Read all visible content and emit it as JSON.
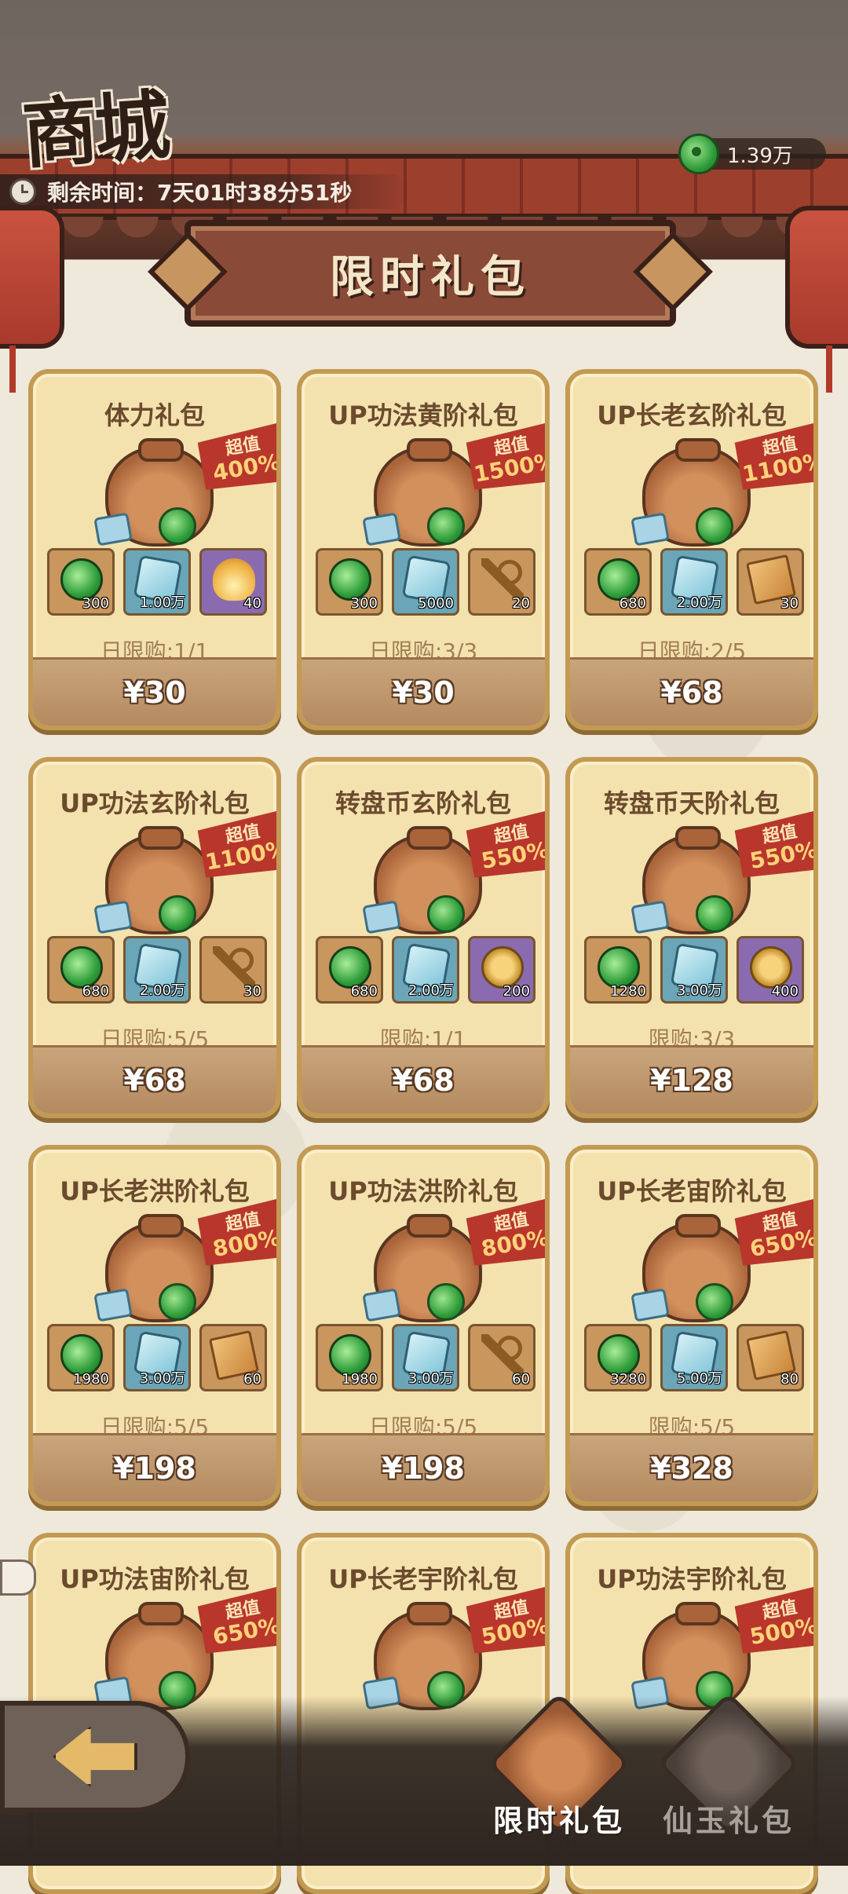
{
  "header": {
    "title": "商城",
    "timer_label": "剩余时间：",
    "timer_value": "7天01时38分51秒",
    "currency_amount": "1.39万",
    "banner": "限时礼包"
  },
  "cards": [
    {
      "name": "体力礼包",
      "badge_top": "超值",
      "badge_pct": "400%",
      "items": [
        {
          "icon": "jade-icon",
          "bg": "brown",
          "count": "300"
        },
        {
          "icon": "crystal-icon",
          "bg": "blue",
          "count": "1.00万"
        },
        {
          "icon": "flame-icon",
          "bg": "purple",
          "count": "40"
        }
      ],
      "limit": "日限购:1/1",
      "price": "¥30"
    },
    {
      "name": "UP功法黄阶礼包",
      "badge_top": "超值",
      "badge_pct": "1500%",
      "items": [
        {
          "icon": "jade-icon",
          "bg": "brown",
          "count": "300"
        },
        {
          "icon": "crystal-icon",
          "bg": "blue",
          "count": "5000"
        },
        {
          "icon": "key-icon",
          "bg": "brown",
          "count": "20"
        }
      ],
      "limit": "日限购:3/3",
      "price": "¥30"
    },
    {
      "name": "UP长老玄阶礼包",
      "badge_top": "超值",
      "badge_pct": "1100%",
      "items": [
        {
          "icon": "jade-icon",
          "bg": "brown",
          "count": "680"
        },
        {
          "icon": "crystal-icon",
          "bg": "blue",
          "count": "2.00万"
        },
        {
          "icon": "scroll-icon",
          "bg": "brown",
          "count": "30"
        }
      ],
      "limit": "日限购:2/5",
      "price": "¥68"
    },
    {
      "name": "UP功法玄阶礼包",
      "badge_top": "超值",
      "badge_pct": "1100%",
      "items": [
        {
          "icon": "jade-icon",
          "bg": "brown",
          "count": "680"
        },
        {
          "icon": "crystal-icon",
          "bg": "blue",
          "count": "2.00万"
        },
        {
          "icon": "key-icon",
          "bg": "brown",
          "count": "30"
        }
      ],
      "limit": "日限购:5/5",
      "price": "¥68"
    },
    {
      "name": "转盘币玄阶礼包",
      "badge_top": "超值",
      "badge_pct": "550%",
      "items": [
        {
          "icon": "jade-icon",
          "bg": "brown",
          "count": "680"
        },
        {
          "icon": "crystal-icon",
          "bg": "blue",
          "count": "2.00万"
        },
        {
          "icon": "coin-icon",
          "bg": "purple",
          "count": "200"
        }
      ],
      "limit": "限购:1/1",
      "price": "¥68"
    },
    {
      "name": "转盘币天阶礼包",
      "badge_top": "超值",
      "badge_pct": "550%",
      "items": [
        {
          "icon": "jade-icon",
          "bg": "brown",
          "count": "1280"
        },
        {
          "icon": "crystal-icon",
          "bg": "blue",
          "count": "3.00万"
        },
        {
          "icon": "coin-icon",
          "bg": "purple",
          "count": "400"
        }
      ],
      "limit": "限购:3/3",
      "price": "¥128"
    },
    {
      "name": "UP长老洪阶礼包",
      "badge_top": "超值",
      "badge_pct": "800%",
      "items": [
        {
          "icon": "jade-icon",
          "bg": "brown",
          "count": "1980"
        },
        {
          "icon": "crystal-icon",
          "bg": "blue",
          "count": "3.00万"
        },
        {
          "icon": "scroll-icon",
          "bg": "brown",
          "count": "60"
        }
      ],
      "limit": "日限购:5/5",
      "price": "¥198"
    },
    {
      "name": "UP功法洪阶礼包",
      "badge_top": "超值",
      "badge_pct": "800%",
      "items": [
        {
          "icon": "jade-icon",
          "bg": "brown",
          "count": "1980"
        },
        {
          "icon": "crystal-icon",
          "bg": "blue",
          "count": "3.00万"
        },
        {
          "icon": "key-icon",
          "bg": "brown",
          "count": "60"
        }
      ],
      "limit": "日限购:5/5",
      "price": "¥198"
    },
    {
      "name": "UP长老宙阶礼包",
      "badge_top": "超值",
      "badge_pct": "650%",
      "items": [
        {
          "icon": "jade-icon",
          "bg": "brown",
          "count": "3280"
        },
        {
          "icon": "crystal-icon",
          "bg": "blue",
          "count": "5.00万"
        },
        {
          "icon": "scroll-icon",
          "bg": "brown",
          "count": "80"
        }
      ],
      "limit": "限购:5/5",
      "price": "¥328"
    },
    {
      "name": "UP功法宙阶礼包",
      "badge_top": "超值",
      "badge_pct": "650%",
      "items": [],
      "limit": "",
      "price": ""
    },
    {
      "name": "UP长老宇阶礼包",
      "badge_top": "超值",
      "badge_pct": "500%",
      "items": [],
      "limit": "",
      "price": ""
    },
    {
      "name": "UP功法宇阶礼包",
      "badge_top": "超值",
      "badge_pct": "500%",
      "items": [],
      "limit": "",
      "price": ""
    }
  ],
  "nav": {
    "tab_gift_label": "限时礼包",
    "tab_jade_label": "仙玉礼包"
  }
}
